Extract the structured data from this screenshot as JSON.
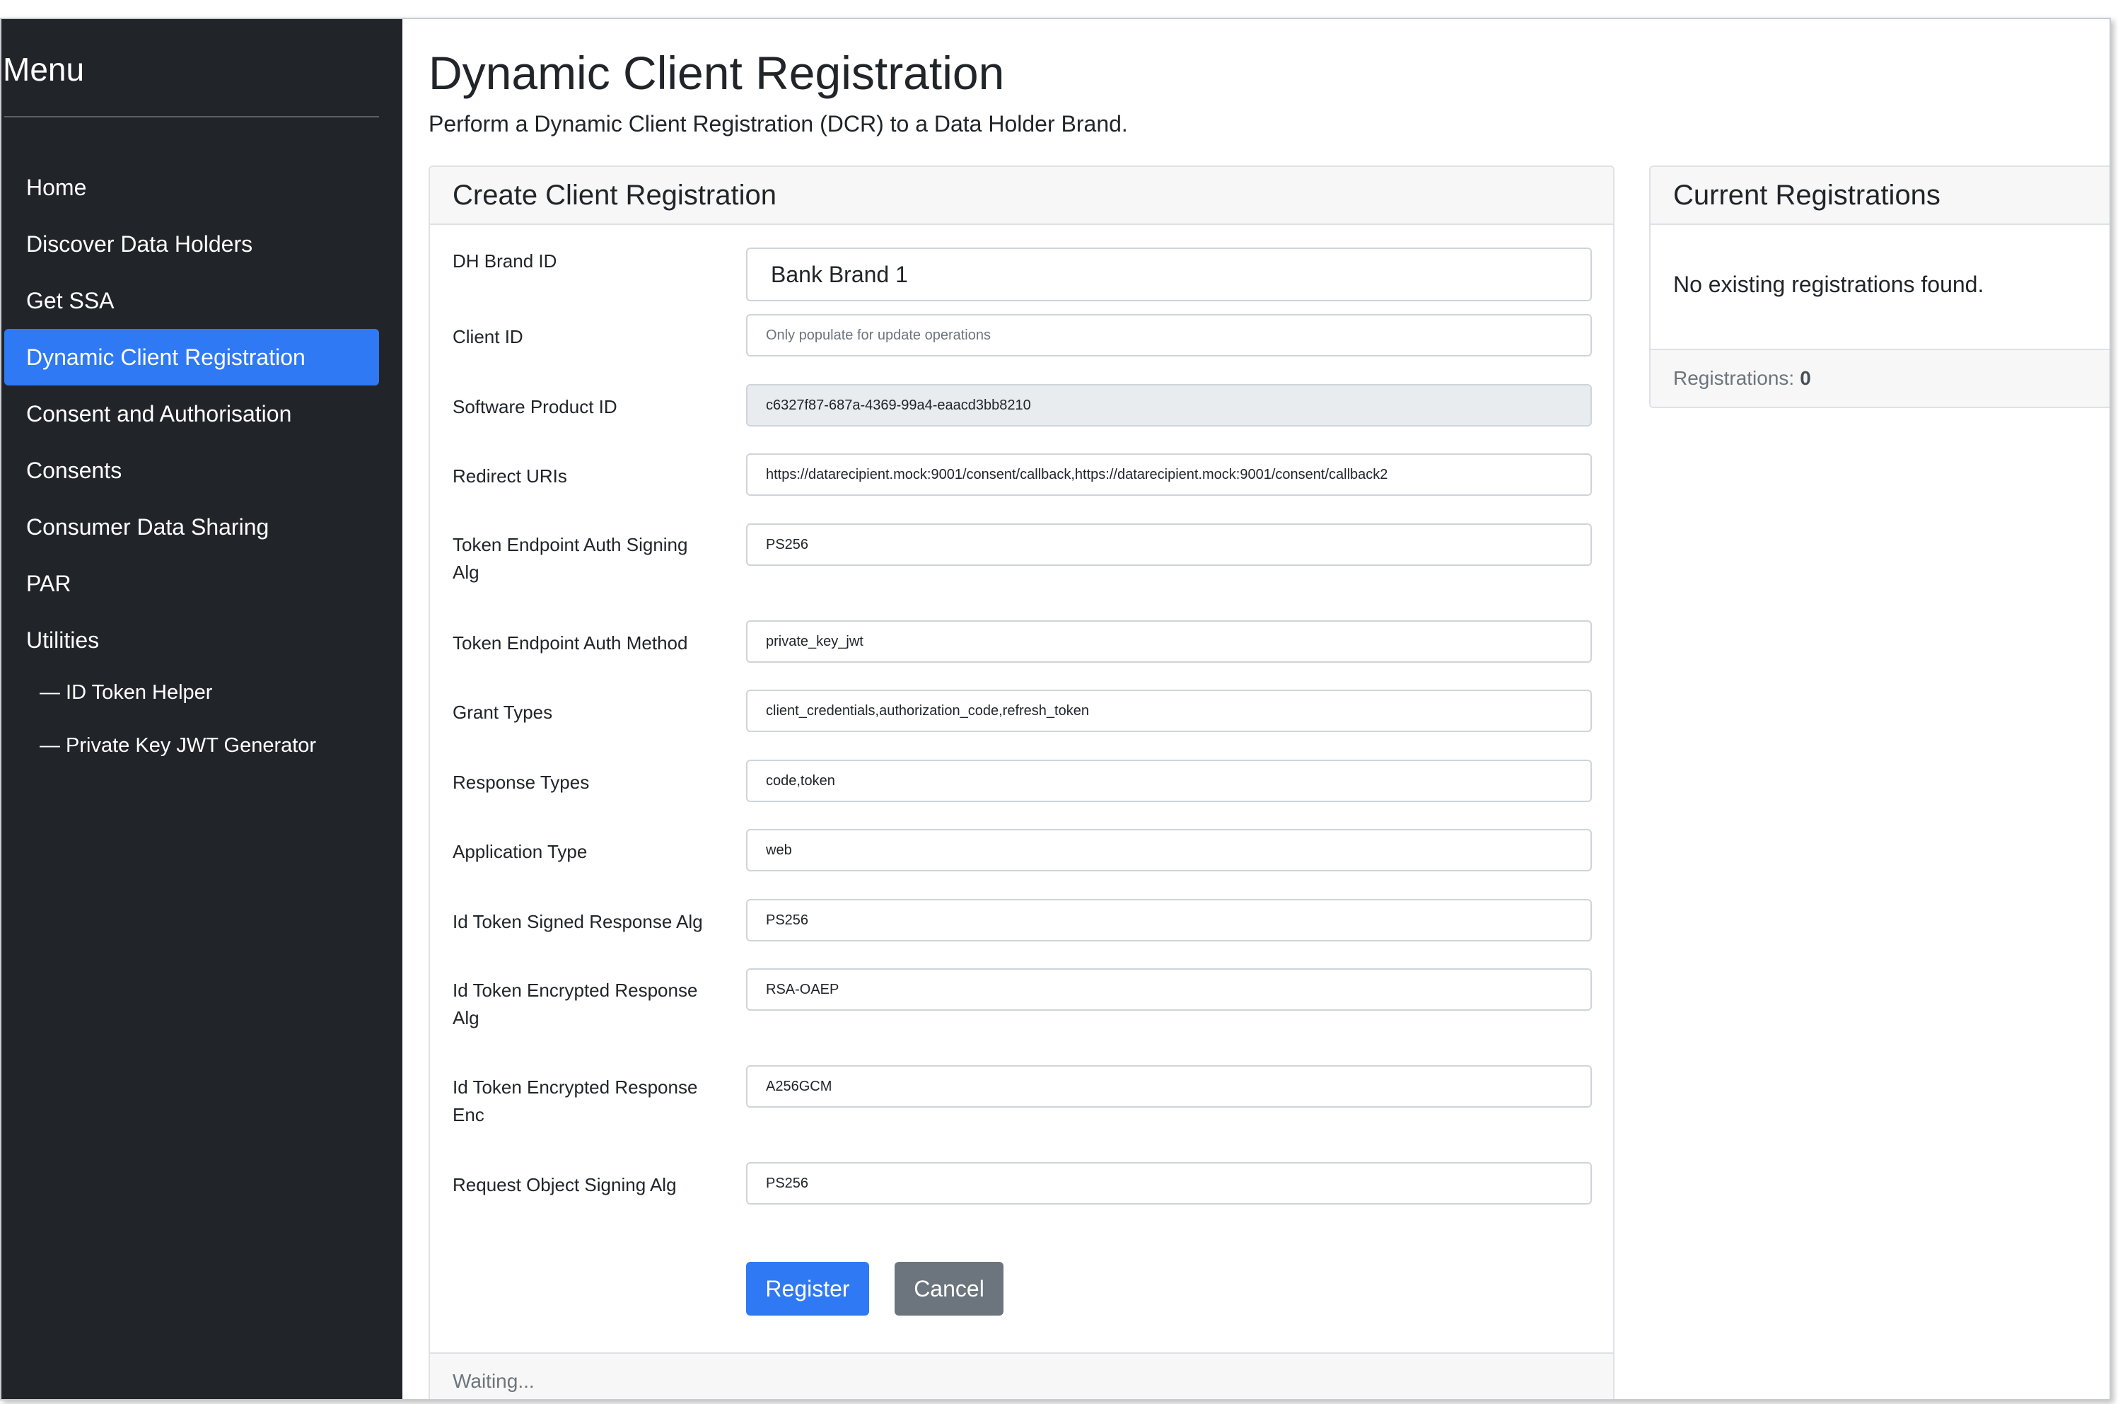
{
  "sidebar": {
    "title": "Menu",
    "items": [
      {
        "label": "Home"
      },
      {
        "label": "Discover Data Holders"
      },
      {
        "label": "Get SSA"
      },
      {
        "label": "Dynamic Client Registration"
      },
      {
        "label": "Consent and Authorisation"
      },
      {
        "label": "Consents"
      },
      {
        "label": "Consumer Data Sharing"
      },
      {
        "label": "PAR"
      },
      {
        "label": "Utilities"
      }
    ],
    "subitems": [
      {
        "label": "— ID Token Helper"
      },
      {
        "label": "— Private Key JWT Generator"
      }
    ]
  },
  "page": {
    "title": "Dynamic Client Registration",
    "description": "Perform a Dynamic Client Registration (DCR) to a Data Holder Brand."
  },
  "create_card": {
    "header": "Create Client Registration",
    "fields": [
      {
        "label": "DH Brand ID",
        "value": "Bank Brand 1"
      },
      {
        "label": "Client ID",
        "value": "",
        "placeholder": "Only populate for update operations"
      },
      {
        "label": "Software Product ID",
        "value": "c6327f87-687a-4369-99a4-eaacd3bb8210"
      },
      {
        "label": "Redirect URIs",
        "value": "https://datarecipient.mock:9001/consent/callback,https://datarecipient.mock:9001/consent/callback2"
      },
      {
        "label": "Token Endpoint Auth Signing Alg",
        "value": "PS256"
      },
      {
        "label": "Token Endpoint Auth Method",
        "value": "private_key_jwt"
      },
      {
        "label": "Grant Types",
        "value": "client_credentials,authorization_code,refresh_token"
      },
      {
        "label": "Response Types",
        "value": "code,token"
      },
      {
        "label": "Application Type",
        "value": "web"
      },
      {
        "label": "Id Token Signed Response Alg",
        "value": "PS256"
      },
      {
        "label": "Id Token Encrypted Response Alg",
        "value": "RSA-OAEP"
      },
      {
        "label": "Id Token Encrypted Response Enc",
        "value": "A256GCM"
      },
      {
        "label": "Request Object Signing Alg",
        "value": "PS256"
      }
    ],
    "register_label": "Register",
    "cancel_label": "Cancel",
    "status": "Waiting..."
  },
  "current_card": {
    "header": "Current Registrations",
    "empty_message": "No existing registrations found.",
    "count_label": "Registrations:",
    "count": "0"
  },
  "colors": {
    "sidebar_bg": "#212529",
    "active_nav": "#2f79f5",
    "primary_button": "#2f79f5",
    "secondary_button": "#6c757d"
  }
}
